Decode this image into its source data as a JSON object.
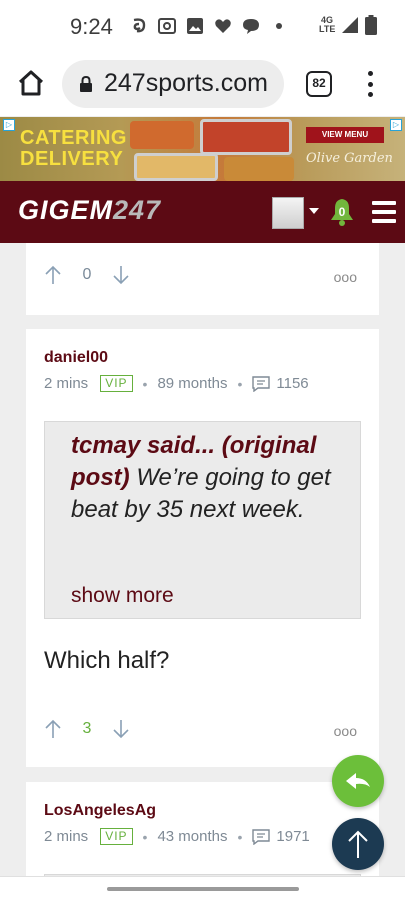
{
  "status_bar": {
    "time": "9:24",
    "network": "4G LTE",
    "icons": [
      "mail-notification-icon",
      "radio-icon",
      "image-icon",
      "heart-icon",
      "chat-bubble-icon",
      "dot-icon",
      "signal-icon",
      "battery-icon"
    ]
  },
  "browser": {
    "url": "247sports.com",
    "tab_count": "82",
    "icons": [
      "home-icon",
      "lock-icon",
      "overflow-menu-icon"
    ]
  },
  "ad": {
    "headline_line1": "CATERING",
    "headline_line2": "DELIVERY",
    "cta": "VIEW MENU",
    "brand": "Olive Garden"
  },
  "site_header": {
    "logo_part1": "GIGEM",
    "logo_part2": "247",
    "notification_count": "0"
  },
  "posts": [
    {
      "upvotes": "0",
      "more_label": "ooo"
    },
    {
      "username": "daniel00",
      "time_ago": "2 mins",
      "badge": "VIP",
      "membership": "89 months",
      "post_count": "1156",
      "quote_author": "tcmay said... (original post)",
      "quote_text": "We’re going to get beat by 35 next week.",
      "show_more": "show more",
      "body": "Which half?",
      "upvotes": "3",
      "more_label": "ooo"
    },
    {
      "username": "LosAngelesAg",
      "time_ago": "2 mins",
      "badge": "VIP",
      "membership": "43 months",
      "post_count": "1971"
    }
  ],
  "colors": {
    "brand_maroon": "#5c0a14",
    "vip_green": "#66b03d",
    "reply_fab": "#6cbf3a",
    "top_fab": "#1c3a52"
  }
}
